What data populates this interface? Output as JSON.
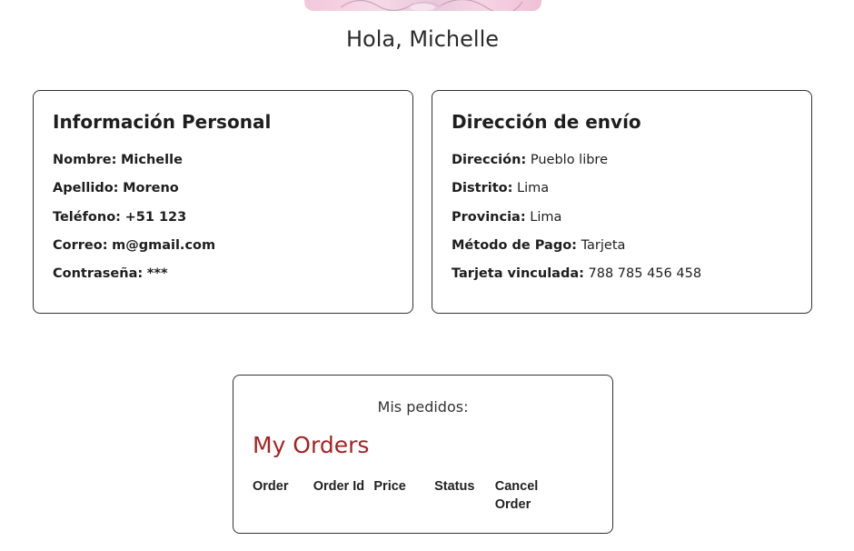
{
  "greeting": "Hola, Michelle",
  "personal": {
    "title": "Información Personal",
    "fields": [
      {
        "label": "Nombre:",
        "value": "Michelle"
      },
      {
        "label": "Apellido:",
        "value": "Moreno"
      },
      {
        "label": "Teléfono:",
        "value": "+51 123"
      },
      {
        "label": "Correo:",
        "value": "m@gmail.com"
      },
      {
        "label": "Contraseña:",
        "value": "***"
      }
    ]
  },
  "shipping": {
    "title": "Dirección de envío",
    "fields": [
      {
        "label": "Dirección:",
        "value": "Pueblo libre"
      },
      {
        "label": "Distrito:",
        "value": "Lima"
      },
      {
        "label": "Provincia:",
        "value": "Lima"
      },
      {
        "label": "Método de Pago:",
        "value": "Tarjeta"
      },
      {
        "label": "Tarjeta vinculada:",
        "value": "788 785 456 458"
      }
    ]
  },
  "orders": {
    "caption": "Mis pedidos:",
    "title": "My Orders",
    "title_color": "#a52323",
    "columns": [
      "Order",
      "Order Id",
      "Price",
      "Status",
      "Cancel Order"
    ]
  }
}
